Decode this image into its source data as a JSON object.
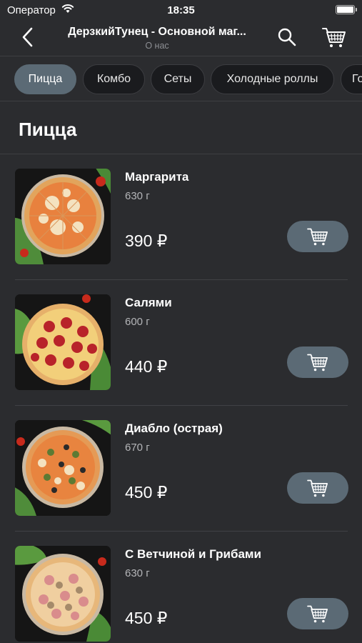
{
  "status_bar": {
    "carrier": "Оператор",
    "time": "18:35"
  },
  "nav": {
    "title": "ДерзкийТунец - Основной маг...",
    "subtitle": "О нас"
  },
  "categories": [
    "Пицца",
    "Комбо",
    "Сеты",
    "Холодные роллы",
    "Го"
  ],
  "section": {
    "title": "Пицца"
  },
  "products": [
    {
      "name": "Маргарита",
      "weight": "630 г",
      "price": "390 ₽"
    },
    {
      "name": "Салями",
      "weight": "600 г",
      "price": "440 ₽"
    },
    {
      "name": "Диабло (острая)",
      "weight": "670 г",
      "price": "450 ₽"
    },
    {
      "name": "С Ветчиной и Грибами",
      "weight": "630 г",
      "price": "450 ₽"
    }
  ],
  "colors": {
    "background": "#2b2c2f",
    "accent": "#5b6a75",
    "tab": "#1a1b1e"
  }
}
